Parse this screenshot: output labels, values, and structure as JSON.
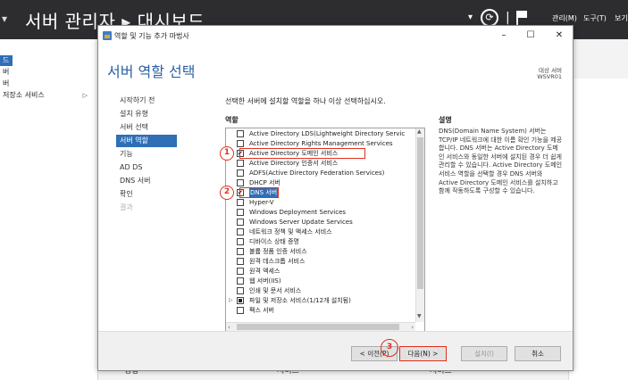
{
  "server_manager": {
    "title": "서버 관리자 ▸ 대시보드",
    "menu": [
      "관리(M)",
      "도구(T)",
      "보기"
    ],
    "sidebar": [
      {
        "label": "드"
      },
      {
        "label": "버"
      },
      {
        "label": "버"
      },
      {
        "label": "저장소 서비스"
      }
    ],
    "bottom_labels": [
      "성능",
      "서비스",
      "서비스"
    ]
  },
  "wizard": {
    "window_title": "역할 및 기능 추가 마법사",
    "controls": {
      "minimize": "–",
      "maximize": "☐",
      "close": "✕"
    },
    "heading": "서버 역할 선택",
    "target_label": "대상 서버",
    "target_value": "WSVR01",
    "nav": [
      {
        "label": "시작하기 전",
        "state": "normal"
      },
      {
        "label": "설치 유형",
        "state": "normal"
      },
      {
        "label": "서버 선택",
        "state": "normal"
      },
      {
        "label": "서버 역할",
        "state": "active"
      },
      {
        "label": "기능",
        "state": "normal"
      },
      {
        "label": "AD DS",
        "state": "normal"
      },
      {
        "label": "DNS 서버",
        "state": "normal"
      },
      {
        "label": "확인",
        "state": "normal"
      },
      {
        "label": "결과",
        "state": "disabled"
      }
    ],
    "instruction": "선택한 서버에 설치할 역할을 하나 이상 선택하십시오.",
    "roles_header": "역할",
    "description_header": "설명",
    "roles": [
      {
        "label": "Active Directory LDS(Lightweight Directory Servic",
        "checked": false
      },
      {
        "label": "Active Directory Rights Management Services",
        "checked": false
      },
      {
        "label": "Active Directory 도메인 서비스",
        "checked": true
      },
      {
        "label": "Active Directory 인증서 서비스",
        "checked": false
      },
      {
        "label": "ADFS(Active Directory Federation Services)",
        "checked": false
      },
      {
        "label": "DHCP 서버",
        "checked": false
      },
      {
        "label": "DNS 서버",
        "checked": true,
        "highlight": true
      },
      {
        "label": "Hyper-V",
        "checked": false
      },
      {
        "label": "Windows Deployment Services",
        "checked": false
      },
      {
        "label": "Windows Server Update Services",
        "checked": false
      },
      {
        "label": "네트워크 정책 및 액세스 서비스",
        "checked": false
      },
      {
        "label": "디바이스 상태 증명",
        "checked": false
      },
      {
        "label": "볼륨 정품 인증 서비스",
        "checked": false
      },
      {
        "label": "원격 데스크톱 서비스",
        "checked": false
      },
      {
        "label": "원격 액세스",
        "checked": false
      },
      {
        "label": "웹 서버(IIS)",
        "checked": false
      },
      {
        "label": "인쇄 및 문서 서비스",
        "checked": false
      },
      {
        "label": "파일 및 저장소 서비스(1/12개 설치됨)",
        "checked": "partial",
        "expandable": true
      },
      {
        "label": "팩스 서버",
        "checked": false
      }
    ],
    "description": "DNS(Domain Name System) 서버는 TCP/IP 네트워크에 대한 이름 확인 기능을 제공합니다. DNS 서버는 Active Directory 도메인 서비스와 동일한 서버에 설치된 경우 더 쉽게 관리할 수 있습니다. Active Directory 도메인 서비스 역할을 선택할 경우 DNS 서버와 Active Directory 도메인 서비스를 설치하고 함께 작동하도록 구성할 수 있습니다.",
    "annotations": [
      "1",
      "2",
      "3"
    ],
    "buttons": {
      "prev": "< 이전(P)",
      "next": "다음(N) >",
      "install": "설치(I)",
      "cancel": "취소"
    }
  }
}
